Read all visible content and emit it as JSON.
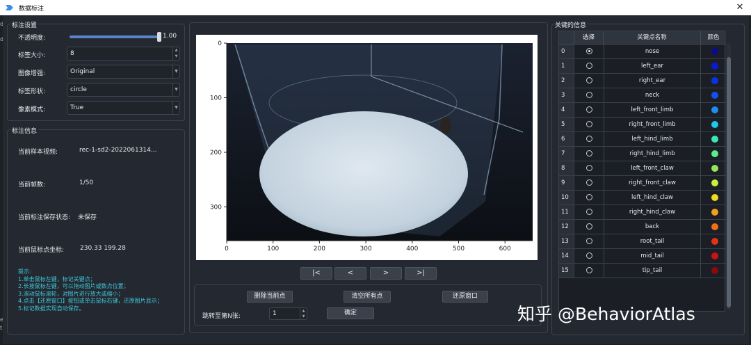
{
  "window": {
    "title": "数据标注"
  },
  "settings": {
    "group_title": "标注设置",
    "opacity_label": "不透明度:",
    "opacity_value": "1.00",
    "size_label": "标签大小:",
    "size_value": "8",
    "enhance_label": "图像增强:",
    "enhance_value": "Original",
    "shape_label": "标签形状:",
    "shape_value": "circle",
    "pixel_label": "像素模式:",
    "pixel_value": "True"
  },
  "info": {
    "group_title": "标注信息",
    "video_label": "当前样本视频:",
    "video_value": "rec-1-sd2-2022061314...",
    "frame_label": "当前帧数:",
    "frame_value": "1/50",
    "save_label": "当前标注保存状态:",
    "save_value": "未保存",
    "coord_label": "当前鼠标点坐标:",
    "coord_value": "230.33  199.28",
    "hints": [
      "提示:",
      "1.单击鼠标左键，标记关键点；",
      "2.长按鼠标左键，可以拖动图片或数点位置；",
      "3.滚动鼠标滚轮，对图片进行放大或缩小；",
      "4.点击【还原窗口】按钮或单击鼠标右键，还原图片显示；",
      "5.标记数据实现自动保存。"
    ]
  },
  "viewer": {
    "x_ticks": [
      "0",
      "100",
      "200",
      "300",
      "400",
      "500",
      "600"
    ],
    "y_ticks": [
      "0",
      "100",
      "200",
      "300"
    ]
  },
  "nav": {
    "first": "|<",
    "prev": "<",
    "next": ">",
    "last": ">|"
  },
  "actions": {
    "delete_label": "删除当前点",
    "clear_label": "清空所有点",
    "restore_label": "还原窗口",
    "jump_label": "跳转至第N张:",
    "jump_value": "1",
    "confirm_label": "确定"
  },
  "keypoints": {
    "group_title": "关键的信息",
    "headers": [
      "选择",
      "关键点名称",
      "颜色"
    ],
    "rows": [
      {
        "idx": "0",
        "name": "nose",
        "color": "#0a0a8c",
        "selected": true
      },
      {
        "idx": "1",
        "name": "left_ear",
        "color": "#0a1ad2",
        "selected": false
      },
      {
        "idx": "2",
        "name": "right_ear",
        "color": "#0a32e6",
        "selected": false
      },
      {
        "idx": "3",
        "name": "neck",
        "color": "#1450f0",
        "selected": false
      },
      {
        "idx": "4",
        "name": "left_front_limb",
        "color": "#1e8cf0",
        "selected": false
      },
      {
        "idx": "5",
        "name": "right_front_limb",
        "color": "#1ec8e6",
        "selected": false
      },
      {
        "idx": "6",
        "name": "left_hind_limb",
        "color": "#3ce6b4",
        "selected": false
      },
      {
        "idx": "7",
        "name": "right_hind_limb",
        "color": "#5aeb8c",
        "selected": false
      },
      {
        "idx": "8",
        "name": "left_front_claw",
        "color": "#96e65a",
        "selected": false
      },
      {
        "idx": "9",
        "name": "right_front_claw",
        "color": "#c8f03c",
        "selected": false
      },
      {
        "idx": "10",
        "name": "left_hind_claw",
        "color": "#f0dc1e",
        "selected": false
      },
      {
        "idx": "11",
        "name": "right_hind_claw",
        "color": "#f0a01e",
        "selected": false
      },
      {
        "idx": "12",
        "name": "back",
        "color": "#f06e14",
        "selected": false
      },
      {
        "idx": "13",
        "name": "root_tail",
        "color": "#e63214",
        "selected": false
      },
      {
        "idx": "14",
        "name": "mid_tail",
        "color": "#c81414",
        "selected": false
      },
      {
        "idx": "15",
        "name": "tip_tail",
        "color": "#8c0a0a",
        "selected": false
      }
    ]
  },
  "watermark": "知乎 @BehaviorAtlas",
  "stray": {
    "left_top": "d",
    "left_mid": "d",
    "left_e": "e",
    "left_t": "t"
  }
}
